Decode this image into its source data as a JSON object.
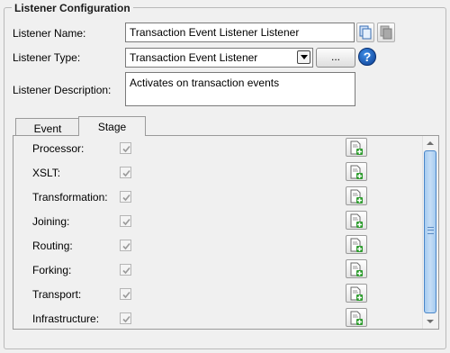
{
  "group": {
    "title": "Listener Configuration"
  },
  "form": {
    "name_label": "Listener Name:",
    "name_value": "Transaction Event Listener Listener",
    "type_label": "Listener Type:",
    "type_value": "Transaction Event Listener",
    "browse_label": "...",
    "help_label": "?",
    "description_label": "Listener Description:",
    "description_value": "Activates on transaction events"
  },
  "tabs": [
    {
      "label": "Event",
      "active": false
    },
    {
      "label": "Stage",
      "active": true
    }
  ],
  "stages": [
    {
      "name": "Processor:",
      "checked": true
    },
    {
      "name": "XSLT:",
      "checked": true
    },
    {
      "name": "Transformation:",
      "checked": true
    },
    {
      "name": "Joining:",
      "checked": true
    },
    {
      "name": "Routing:",
      "checked": true
    },
    {
      "name": "Forking:",
      "checked": true
    },
    {
      "name": "Transport:",
      "checked": true
    },
    {
      "name": "Infrastructure:",
      "checked": true
    }
  ],
  "icons": {
    "copy": "copy-icon",
    "paste": "paste-icon",
    "dropdown": "chevron-down-icon",
    "help": "help-icon",
    "add_document": "add-document-icon"
  },
  "colors": {
    "scroll_thumb": "#a6cbf0",
    "help_blue": "#0b3d91",
    "add_plus": "#2e9c2e"
  }
}
